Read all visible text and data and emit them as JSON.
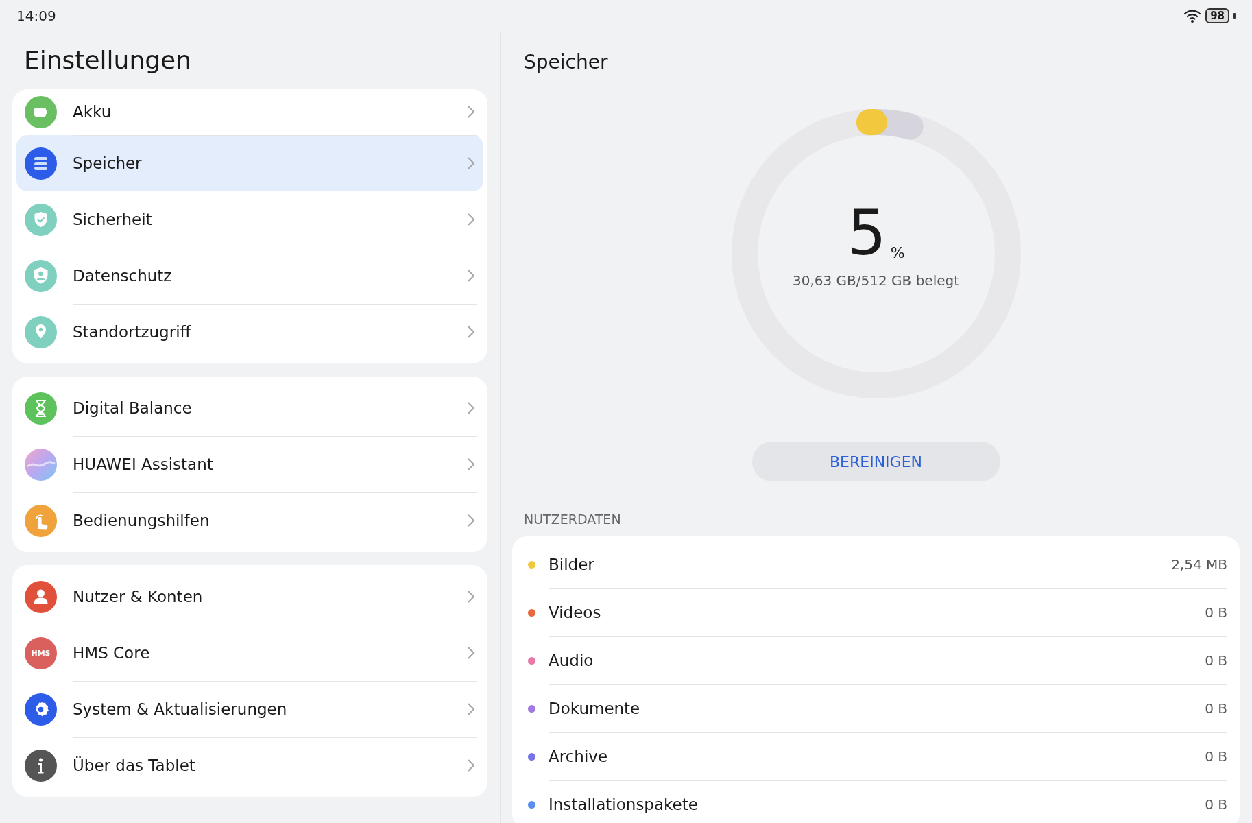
{
  "status_bar": {
    "time": "14:09",
    "battery": "98"
  },
  "sidebar": {
    "title": "Einstellungen",
    "groups": [
      [
        {
          "label": "Akku",
          "kind": "battery",
          "selected": false
        },
        {
          "label": "Speicher",
          "kind": "storage",
          "selected": true
        },
        {
          "label": "Sicherheit",
          "kind": "shield",
          "selected": false
        },
        {
          "label": "Datenschutz",
          "kind": "privacy",
          "selected": false
        },
        {
          "label": "Standortzugriff",
          "kind": "location",
          "selected": false
        }
      ],
      [
        {
          "label": "Digital Balance",
          "kind": "hourglass",
          "selected": false
        },
        {
          "label": "HUAWEI Assistant",
          "kind": "assistant",
          "selected": false
        },
        {
          "label": "Bedienungshilfen",
          "kind": "hand",
          "selected": false
        }
      ],
      [
        {
          "label": "Nutzer & Konten",
          "kind": "user",
          "selected": false
        },
        {
          "label": "HMS Core",
          "kind": "hms",
          "icon_text": "HMS",
          "selected": false
        },
        {
          "label": "System & Aktualisierungen",
          "kind": "gear",
          "selected": false
        },
        {
          "label": "Über das Tablet",
          "kind": "info",
          "selected": false
        }
      ]
    ]
  },
  "detail": {
    "title": "Speicher",
    "usage": {
      "percent": "5",
      "unit": "%",
      "caption": "30,63 GB/512 GB belegt"
    },
    "button": "BEREINIGEN",
    "section": "NUTZERDATEN",
    "items": [
      {
        "label": "Bilder",
        "value": "2,54 MB",
        "color": "#f2c93e"
      },
      {
        "label": "Videos",
        "value": "0 B",
        "color": "#e8683f"
      },
      {
        "label": "Audio",
        "value": "0 B",
        "color": "#e879a8"
      },
      {
        "label": "Dokumente",
        "value": "0 B",
        "color": "#a07be3"
      },
      {
        "label": "Archive",
        "value": "0 B",
        "color": "#7674e8"
      },
      {
        "label": "Installationspakete",
        "value": "0 B",
        "color": "#5b8ef0"
      }
    ]
  }
}
